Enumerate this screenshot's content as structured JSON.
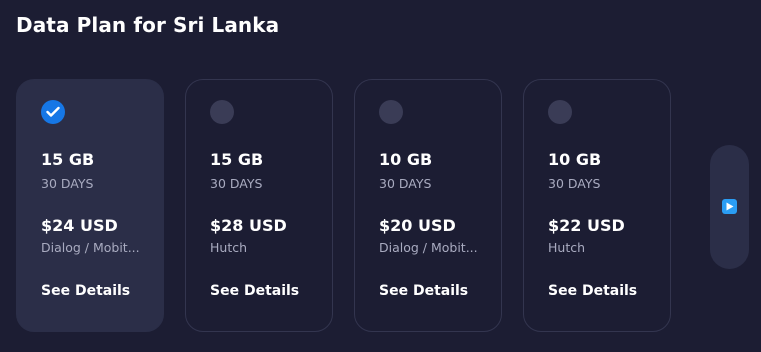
{
  "page": {
    "title": "Data Plan for Sri Lanka"
  },
  "plans": [
    {
      "data": "15 GB",
      "validity": "30 DAYS",
      "price": "$24 USD",
      "operator": "Dialog / Mobit...",
      "details_label": "See Details",
      "selected": true
    },
    {
      "data": "15 GB",
      "validity": "30 DAYS",
      "price": "$28 USD",
      "operator": "Hutch",
      "details_label": "See Details",
      "selected": false
    },
    {
      "data": "10 GB",
      "validity": "30 DAYS",
      "price": "$20 USD",
      "operator": "Dialog / Mobit...",
      "details_label": "See Details",
      "selected": false
    },
    {
      "data": "10 GB",
      "validity": "30 DAYS",
      "price": "$22 USD",
      "operator": "Hutch",
      "details_label": "See Details",
      "selected": false
    }
  ],
  "icons": {
    "selected": "check-icon",
    "next": "play-icon"
  },
  "colors": {
    "background": "#1c1d33",
    "selected_card": "#2b2e48",
    "accent": "#1677e6",
    "next_icon": "#2a9df4"
  }
}
